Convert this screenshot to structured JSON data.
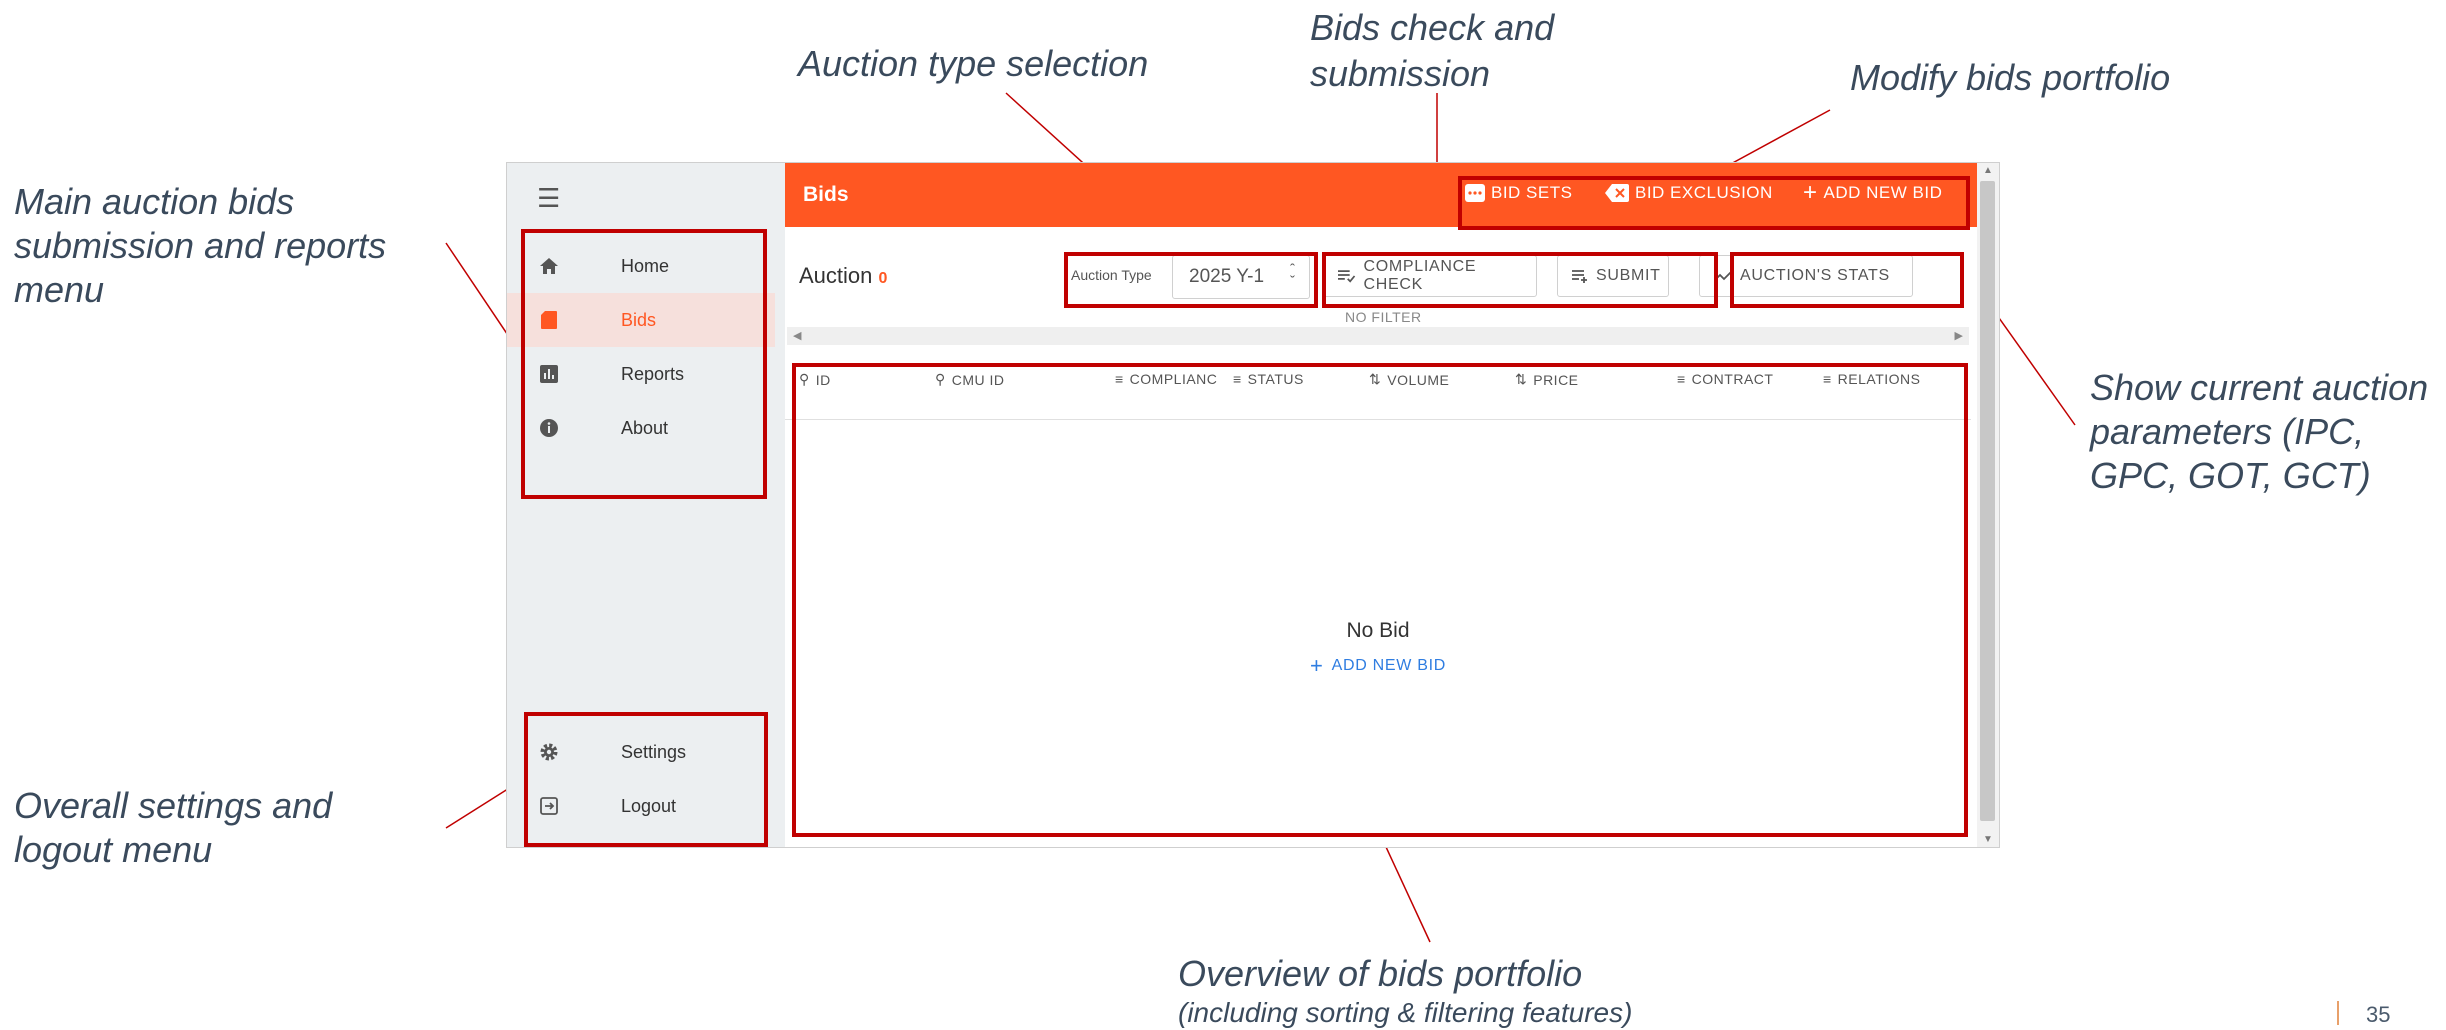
{
  "annotations": {
    "auction_type_selection": "Auction type selection",
    "bids_check_line1": "Bids check and",
    "bids_check_line2": "submission",
    "modify_portfolio": "Modify bids portfolio",
    "main_menu_line1": "Main auction bids",
    "main_menu_line2": "submission  and reports",
    "main_menu_line3": "menu",
    "auction_params_line1": "Show current auction",
    "auction_params_line2": "parameters (IPC,",
    "auction_params_line3": "GPC, GOT, GCT)",
    "settings_line1": "Overall settings and",
    "settings_line2": "logout menu",
    "overview_line1": "Overview of bids portfolio",
    "overview_line2": "(including sorting & filtering features)"
  },
  "page_number": "35",
  "sidebar": {
    "menu_icon": "hamburger-icon",
    "items": [
      {
        "label": "Home",
        "icon": "home-icon",
        "active": false
      },
      {
        "label": "Bids",
        "icon": "bids-icon",
        "active": true
      },
      {
        "label": "Reports",
        "icon": "reports-icon",
        "active": false
      },
      {
        "label": "About",
        "icon": "info-icon",
        "active": false
      }
    ],
    "bottom_items": [
      {
        "label": "Settings",
        "icon": "gear-icon"
      },
      {
        "label": "Logout",
        "icon": "logout-icon"
      }
    ]
  },
  "topbar": {
    "title": "Bids",
    "bid_sets": "BID SETS",
    "bid_exclusion": "BID EXCLUSION",
    "add_new_bid": "ADD NEW BID"
  },
  "toolbar": {
    "auction_label": "Auction",
    "auction_count": "0",
    "auction_type_label": "Auction Type",
    "auction_type_value": "2025 Y-1",
    "compliance_check": "COMPLIANCE CHECK",
    "submit": "SUBMIT",
    "auction_stats": "AUCTION'S STATS",
    "filter_status": "NO FILTER"
  },
  "table": {
    "columns": [
      "ID",
      "CMU ID",
      "COMPLIANC",
      "STATUS",
      "VOLUME",
      "PRICE",
      "CONTRACT",
      "RELATIONS"
    ],
    "empty_text": "No Bid",
    "empty_action": "ADD NEW BID"
  },
  "colors": {
    "accent": "#ff5722",
    "annotation_box": "#c00000",
    "link": "#2f7de1",
    "sidebar_bg": "#eceff1"
  }
}
